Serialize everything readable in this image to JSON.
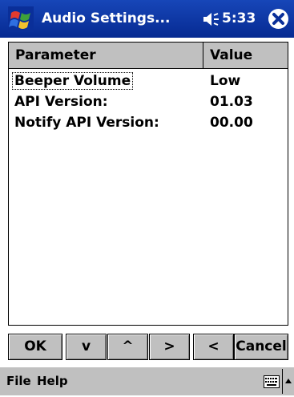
{
  "titlebar": {
    "title": "Audio Settings...",
    "time": "5:33",
    "start_icon": "windows-flag-icon",
    "speaker_icon": "speaker-icon",
    "close_icon": "close-icon",
    "bar_color": "#0a2f99"
  },
  "list": {
    "columns": [
      "Parameter",
      "Value"
    ],
    "rows": [
      {
        "parameter": "Beeper Volume",
        "value": "Low"
      },
      {
        "parameter": "API Version:",
        "value": "01.03"
      },
      {
        "parameter": "Notify API Version:",
        "value": "00.00"
      }
    ]
  },
  "buttons": {
    "ok": "OK",
    "down": "v",
    "up": "^",
    "right": ">",
    "left": "<",
    "cancel": "Cancel"
  },
  "menubar": {
    "file": "File",
    "help": "Help",
    "keyboard_icon": "keyboard-icon",
    "sip_icon": "arrow-up-icon"
  }
}
